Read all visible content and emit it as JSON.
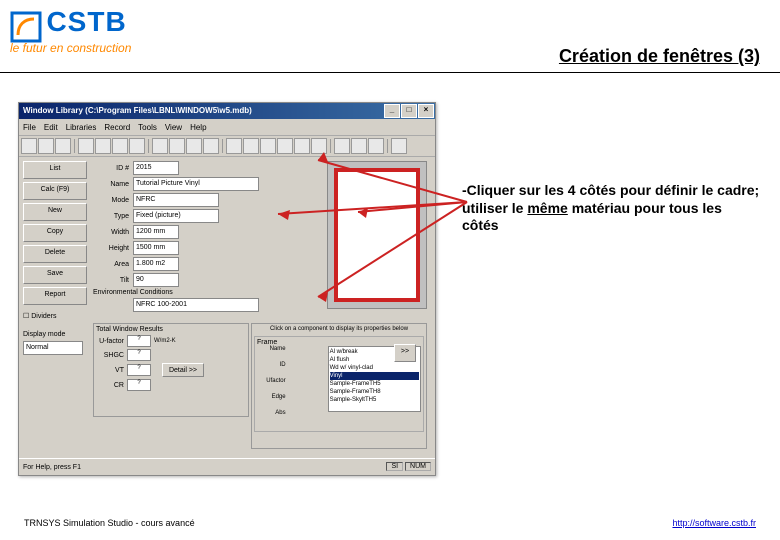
{
  "header": {
    "logo_main": "CSTB",
    "logo_tag": "le futur en construction",
    "slide_title": "Création de fenêtres (3)"
  },
  "window": {
    "title": "Window Library (C:\\Program Files\\LBNL\\WINDOW5\\w5.mdb)",
    "titlebar_min": "_",
    "titlebar_max": "□",
    "titlebar_close": "×",
    "menu": [
      "File",
      "Edit",
      "Libraries",
      "Record",
      "Tools",
      "View",
      "Help"
    ],
    "left_buttons": [
      "List",
      "Calc (F9)",
      "New",
      "Copy",
      "Delete",
      "Save",
      "Report"
    ],
    "dividers_label": "Dividers",
    "display_mode_label": "Display mode",
    "display_mode_value": "Normal",
    "form": {
      "id_label": "ID #",
      "id_value": "2015",
      "name_label": "Name",
      "name_value": "Tutorial Picture Vinyl",
      "mode_label": "Mode",
      "mode_value": "NFRC",
      "type_label": "Type",
      "type_value": "Fixed (picture)",
      "width_label": "Width",
      "width_value": "1200 mm",
      "height_label": "Height",
      "height_value": "1500 mm",
      "area_label": "Area",
      "area_value": "1.800 m2",
      "tilt_label": "Tilt",
      "tilt_value": "90",
      "env_label": "Environmental Conditions",
      "env_value": "NFRC 100-2001"
    },
    "results": {
      "title": "Total Window Results",
      "ufactor_label": "U-factor",
      "ufactor_val": "?",
      "ufactor_unit": "W/m2-K",
      "shgc_label": "SHGC",
      "shgc_val": "?",
      "vt_label": "VT",
      "vt_val": "?",
      "cr_label": "CR",
      "cr_val": "?",
      "detail_btn": "Detail >>"
    },
    "frame_panel": {
      "hint": "Click on a component to display its properties below",
      "group": "Frame",
      "name_label": "Name",
      "add_btn": ">>",
      "id_label": "ID",
      "ufactor_label": "Ufactor",
      "edge_label": "Edge",
      "abs_label": "Abs",
      "options": [
        "Al w/break",
        "Al flush",
        "Wd w/ vinyl-clad",
        "Vinyl",
        "Sample-FrameTH5",
        "Sample-FrameTH8",
        "Sample-SkyltTH5"
      ],
      "selected_index": 3
    },
    "status_left": "For Help, press F1",
    "status_mode": "SI",
    "status_num": "NUM"
  },
  "instruction": {
    "prefix": "-Cliquer sur les 4 côtés pour définir le cadre; utiliser le ",
    "emph": "même",
    "suffix": " matériau pour tous les côtés"
  },
  "footer": {
    "left": "TRNSYS Simulation Studio - cours avancé",
    "right": "http://software.cstb.fr"
  }
}
